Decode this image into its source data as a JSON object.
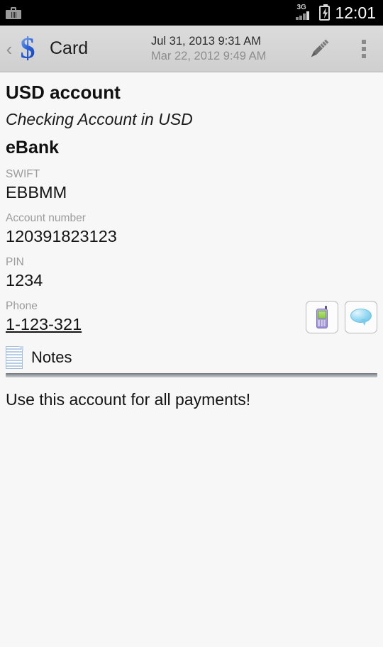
{
  "status_bar": {
    "left_icon": "briefcase-icon",
    "network_type": "3G",
    "battery_icon": "battery-charging-icon",
    "time": "12:01"
  },
  "action_bar": {
    "back_icon": "back-chevron-icon",
    "app_icon": "dollar-sign-icon",
    "app_icon_glyph": "$",
    "title": "Card",
    "date_modified": "Jul 31, 2013 9:31 AM",
    "date_created": "Mar 22, 2012 9:49 AM",
    "edit_icon": "pencil-icon",
    "overflow_icon": "overflow-menu-icon"
  },
  "card": {
    "title": "USD account",
    "subtitle": "Checking Account in USD",
    "organization": "eBank",
    "fields": [
      {
        "label": "SWIFT",
        "value": "EBBMM",
        "is_link": false
      },
      {
        "label": "Account number",
        "value": "120391823123",
        "is_link": false
      },
      {
        "label": "PIN",
        "value": "1234",
        "is_link": false
      }
    ],
    "phone_field": {
      "label": "Phone",
      "value": "1-123-321",
      "call_icon": "mobile-phone-icon",
      "sms_icon": "speech-bubble-icon"
    },
    "notes": {
      "icon": "notes-document-icon",
      "label": "Notes",
      "text": "Use this account for all payments!"
    }
  },
  "colors": {
    "accent_blue": "#2b64d9",
    "status_bar_bg": "#000000",
    "action_bar_bg": "#d4d4d4",
    "content_bg": "#f7f7f7",
    "label_gray": "#9b9b9b"
  }
}
